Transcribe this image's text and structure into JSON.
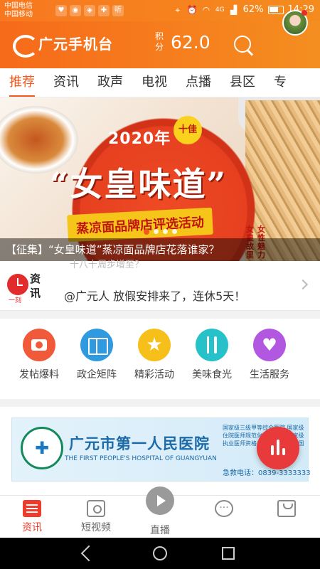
{
  "statusbar": {
    "carrier1": "中国电信",
    "carrier2": "中国移动",
    "notif_icons": [
      "heart-monitor-icon",
      "drop-icon",
      "shield-icon",
      "app-icon",
      "听"
    ],
    "network": "4G",
    "battery": "62%",
    "time": "14:29"
  },
  "appbar": {
    "logo_text": "广元手机台",
    "score_label": "积分",
    "score_value": "62.0"
  },
  "tabs": [
    "推荐",
    "资讯",
    "政声",
    "电视",
    "点播",
    "县区",
    "专"
  ],
  "banner": {
    "year": "2020年",
    "badge": "十佳",
    "title": "“女皇味道”",
    "subtitle": "蒸凉面品牌店评选活动",
    "slogan_a": "女皇故里",
    "slogan_b": "女性魅力",
    "caption": "【征集】“女皇味道”蒸凉面品牌店花落谁家？",
    "slide_count": 4,
    "active_slide": 1
  },
  "news": {
    "logo_top": "资",
    "logo_bottom": "讯",
    "logo_small": "一刻",
    "ghost_text": "十八十周步增至？",
    "headline": "@广元人 放假安排来了，连休5天！"
  },
  "services": [
    {
      "label": "发帖爆料",
      "icon": "camera-icon",
      "color": "#f05a3a"
    },
    {
      "label": "政企矩阵",
      "icon": "book-icon",
      "color": "#2f9ae0"
    },
    {
      "label": "精彩活动",
      "icon": "star-icon",
      "color": "#f7bf1a"
    },
    {
      "label": "美味食光",
      "icon": "fork-knife-icon",
      "color": "#27c1c9"
    },
    {
      "label": "生活服务",
      "icon": "heart-search-icon",
      "color": "#b258e0"
    }
  ],
  "ad": {
    "name": "广元市第一人民医院",
    "english": "THE FIRST PEOPLE'S HOSPITAL OF GUANGYUAN",
    "grades": "国家级三级甲等综合医院 国家级住院医师规范化培训基地 国家级执业医师资格考试 中科院赵志国",
    "phone": "急救电话：0839-3333333"
  },
  "bottomnav": {
    "items": [
      "资讯",
      "短视频",
      "直播",
      "",
      ""
    ],
    "active": "资讯"
  },
  "colors": {
    "accent": "#ef5a1e",
    "appbar": "#f66a1a",
    "red": "#e83a3a"
  }
}
